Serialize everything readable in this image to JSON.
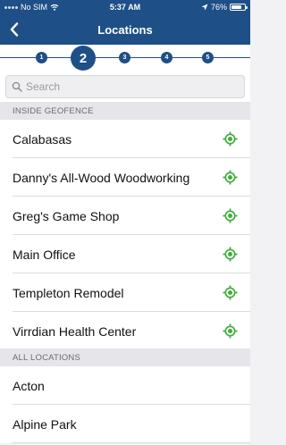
{
  "status": {
    "carrier": "No SIM",
    "time": "5:37 AM",
    "battery": "76%",
    "battery_level": 0.76
  },
  "nav": {
    "title": "Locations",
    "back_icon": "chevron-left-icon"
  },
  "stepper": {
    "steps": [
      "1",
      "2",
      "3",
      "4",
      "5"
    ],
    "current_step": 2
  },
  "search": {
    "placeholder": "Search",
    "value": ""
  },
  "sections": {
    "inside_geofence": {
      "header": "INSIDE GEOFENCE",
      "items": [
        "Calabasas",
        "Danny's All-Wood Woodworking",
        "Greg's Game Shop",
        "Main Office",
        "Templeton Remodel",
        "Virrdian Health Center"
      ]
    },
    "all_locations": {
      "header": "ALL LOCATIONS",
      "items": [
        "Acton",
        "Alpine Park"
      ]
    }
  },
  "colors": {
    "brand": "#1e4f86",
    "geofence_icon": "#3fae3a",
    "background": "#f2f2f4"
  }
}
